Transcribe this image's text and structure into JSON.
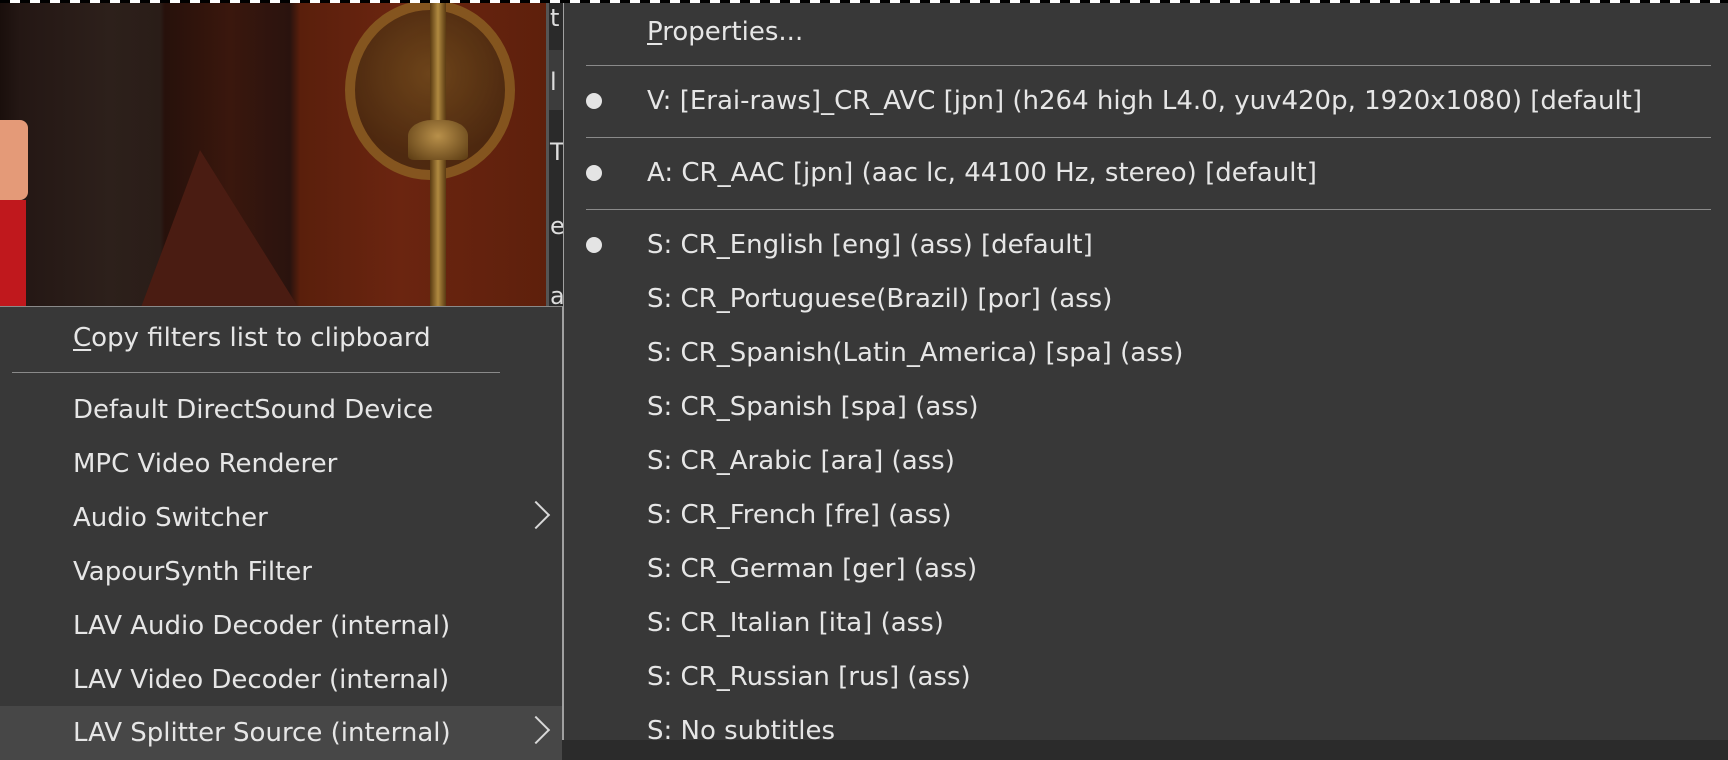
{
  "background_window": {
    "strip_glyphs": [
      "t",
      "l",
      "T",
      "e",
      "a"
    ]
  },
  "filters_menu": {
    "copy_item": {
      "accel": "C",
      "rest": "opy filters list to clipboard"
    },
    "items": [
      {
        "label": "Default DirectSound Device",
        "submenu": false
      },
      {
        "label": "MPC Video Renderer",
        "submenu": false
      },
      {
        "label": "Audio Switcher",
        "submenu": true
      },
      {
        "label": "VapourSynth Filter",
        "submenu": false
      },
      {
        "label": "LAV Audio Decoder (internal)",
        "submenu": false
      },
      {
        "label": "LAV Video Decoder (internal)",
        "submenu": false
      },
      {
        "label": "LAV Splitter Source (internal)",
        "submenu": true,
        "highlighted": true
      }
    ]
  },
  "submenu": {
    "properties": {
      "accel": "P",
      "rest": "roperties..."
    },
    "video_stream": {
      "label": "V: [Erai-raws]_CR_AVC [jpn] (h264 high L4.0, yuv420p, 1920x1080) [default]",
      "selected": true
    },
    "audio_stream": {
      "label": "A: CR_AAC [jpn] (aac lc, 44100 Hz, stereo) [default]",
      "selected": true
    },
    "subtitle_streams": [
      {
        "label": "S: CR_English [eng] (ass) [default]",
        "selected": true
      },
      {
        "label": "S: CR_Portuguese(Brazil) [por] (ass)",
        "selected": false
      },
      {
        "label": "S: CR_Spanish(Latin_America) [spa] (ass)",
        "selected": false
      },
      {
        "label": "S: CR_Spanish [spa] (ass)",
        "selected": false
      },
      {
        "label": "S: CR_Arabic [ara] (ass)",
        "selected": false
      },
      {
        "label": "S: CR_French [fre] (ass)",
        "selected": false
      },
      {
        "label": "S: CR_German [ger] (ass)",
        "selected": false
      },
      {
        "label": "S: CR_Italian [ita] (ass)",
        "selected": false
      },
      {
        "label": "S: CR_Russian [rus] (ass)",
        "selected": false
      },
      {
        "label": "S: No subtitles",
        "selected": false
      }
    ]
  },
  "colors": {
    "menu_bg": "#383838",
    "menu_highlight": "#474747",
    "menu_text": "#e6e6e6",
    "separator": "#8a8a8a"
  }
}
